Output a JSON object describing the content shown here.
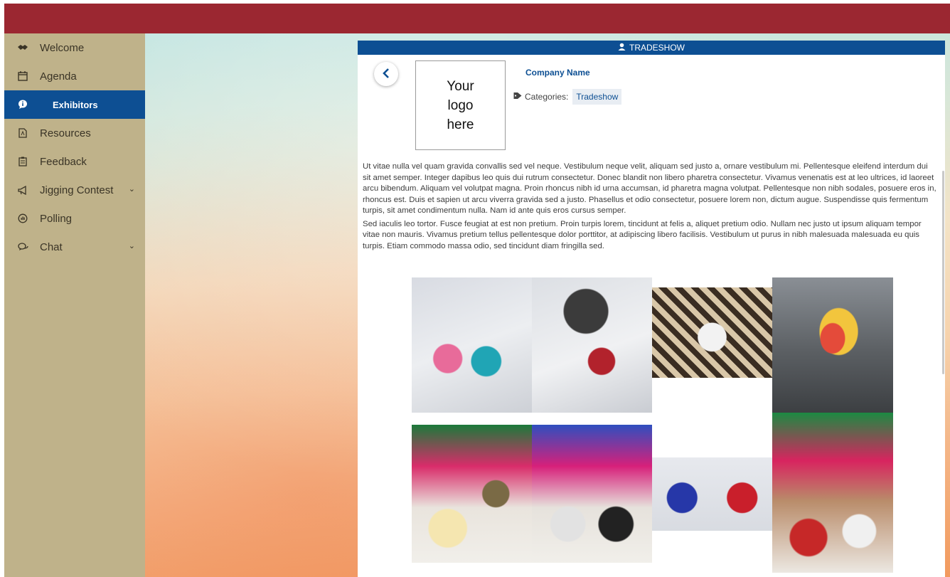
{
  "colors": {
    "top_bar": "#9b2731",
    "sidebar": "#bfb28a",
    "accent": "#0d4f93",
    "active_nav_text": "#ffffff"
  },
  "sidebar": {
    "items": [
      {
        "label": "Welcome",
        "icon": "handshake-icon",
        "active": false,
        "has_chevron": false
      },
      {
        "label": "Agenda",
        "icon": "calendar-icon",
        "active": false,
        "has_chevron": false
      },
      {
        "label": "Exhibitors",
        "icon": "info-bubble-icon",
        "active": true,
        "has_chevron": false
      },
      {
        "label": "Resources",
        "icon": "pdf-file-icon",
        "active": false,
        "has_chevron": false
      },
      {
        "label": "Feedback",
        "icon": "clipboard-icon",
        "active": false,
        "has_chevron": false
      },
      {
        "label": "Jigging Contest",
        "icon": "megaphone-icon",
        "active": false,
        "has_chevron": true
      },
      {
        "label": "Polling",
        "icon": "poll-bubble-icon",
        "active": false,
        "has_chevron": false
      },
      {
        "label": "Chat",
        "icon": "chat-icon",
        "active": false,
        "has_chevron": true
      }
    ]
  },
  "panel": {
    "header_title": "TRADESHOW",
    "header_icon": "user-badge-icon",
    "back_icon": "chevron-left-icon",
    "logo_text": [
      "Your",
      "logo",
      "here"
    ],
    "company_name": "Company Name",
    "categories_label": "Categories:",
    "category_tag": "Tradeshow",
    "description": [
      "Ut vitae nulla vel quam gravida convallis sed vel neque. Vestibulum neque velit, aliquam sed justo a, ornare vestibulum mi. Pellentesque eleifend interdum dui sit amet semper. Integer dapibus leo quis dui rutrum consectetur. Donec blandit non libero pharetra consectetur. Vivamus venenatis est at leo ultrices, id laoreet arcu bibendum. Aliquam vel volutpat magna. Proin rhoncus nibh id urna accumsan, id pharetra magna volutpat. Pellentesque non nibh sodales, posuere eros in, rhoncus est. Duis et sapien ut arcu viverra gravida sed a justo. Phasellus et odio consectetur, posuere lorem non, dictum augue. Suspendisse quis fermentum turpis, sit amet condimentum nulla. Nam id ante quis eros cursus semper.",
      "Sed iaculis leo tortor. Fusce feugiat at est non pretium. Proin turpis lorem, tincidunt at felis a, aliquet pretium odio. Nullam nec justo ut ipsum aliquam tempor vitae non mauris. Vivamus pretium tellus pellentesque dolor porttitor, at adipiscing libero facilisis. Vestibulum ut purus in nibh malesuada malesuada eu quis turpis. Etiam commodo massa odio, sed tincidunt diam fringilla sed."
    ]
  }
}
